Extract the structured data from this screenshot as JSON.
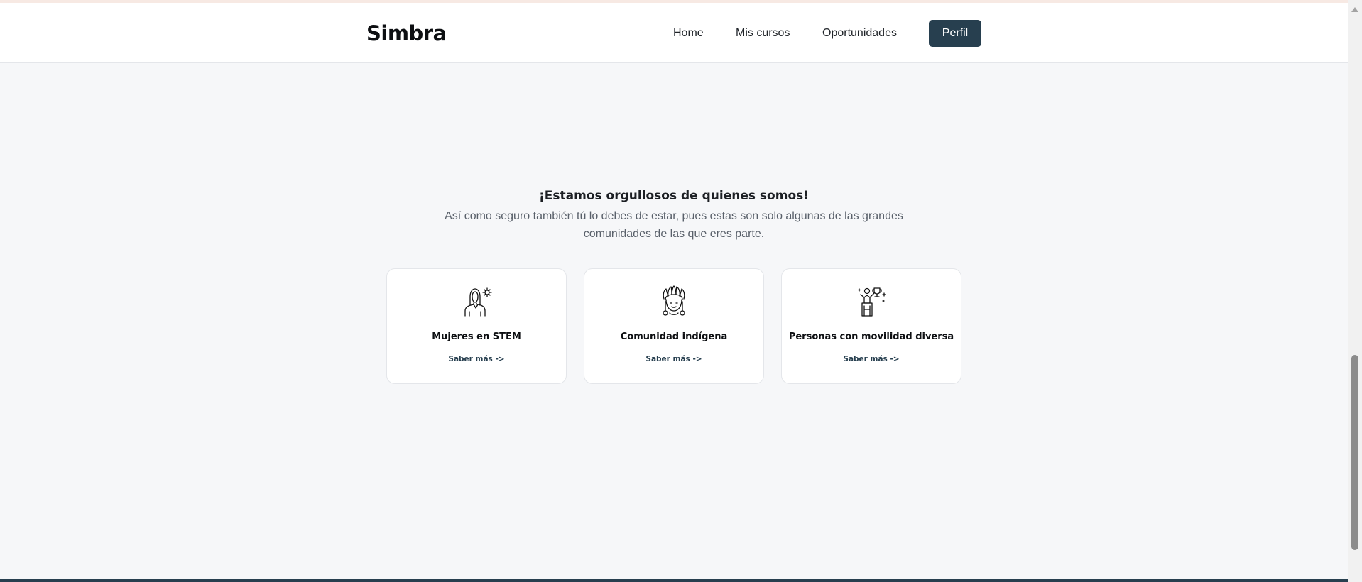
{
  "header": {
    "logo": "Simbra",
    "nav": {
      "home": "Home",
      "courses": "Mis cursos",
      "opportunities": "Oportunidades"
    },
    "profile_button": "Perfil"
  },
  "hero": {
    "title": "¡Estamos orgullosos de quienes somos!",
    "subtitle": "Así como seguro también tú lo debes de estar, pues estas son solo algunas de las grandes comunidades de las que eres parte."
  },
  "cards": [
    {
      "icon": "woman-scientist-icon",
      "title": "Mujeres en STEM",
      "link": "Saber más ->"
    },
    {
      "icon": "indigenous-headdress-icon",
      "title": "Comunidad indígena",
      "link": "Saber más ->"
    },
    {
      "icon": "wheelchair-trophy-icon",
      "title": "Personas con movilidad diversa",
      "link": "Saber más ->"
    }
  ],
  "colors": {
    "brand": "#273f4f",
    "background": "#f6f7f9",
    "card": "#ffffff"
  }
}
